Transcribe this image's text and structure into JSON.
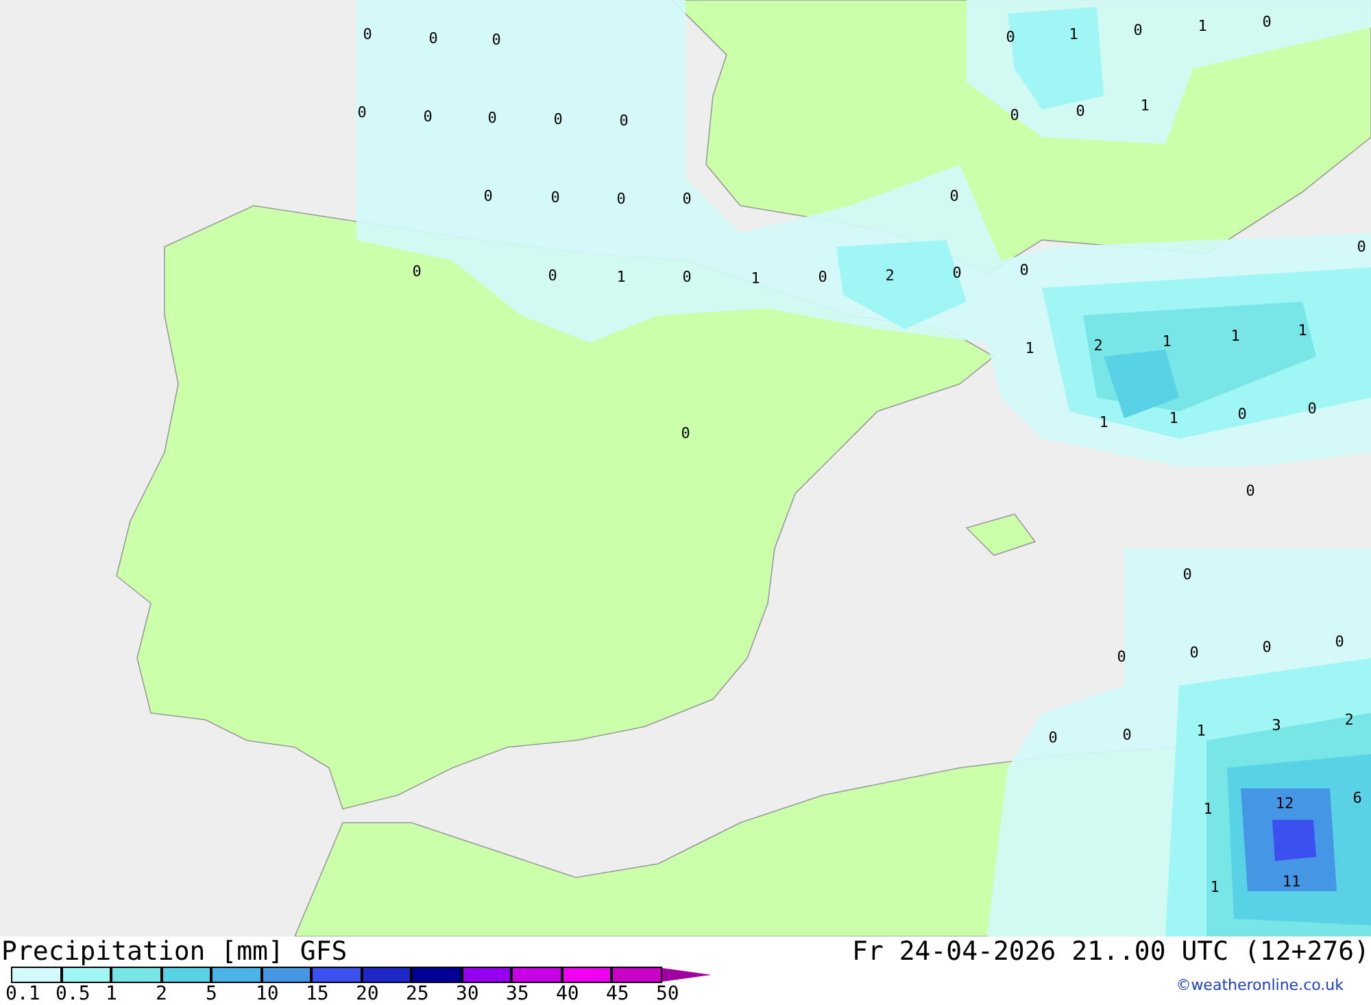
{
  "map": {
    "labels": [
      {
        "text": "0"
      },
      {
        "text": "0"
      },
      {
        "text": "0"
      },
      {
        "text": "0"
      },
      {
        "text": "1"
      },
      {
        "text": "0"
      },
      {
        "text": "1"
      },
      {
        "text": "0"
      },
      {
        "text": "0"
      },
      {
        "text": "0"
      },
      {
        "text": "0"
      },
      {
        "text": "0"
      },
      {
        "text": "0"
      },
      {
        "text": "0"
      },
      {
        "text": "0"
      },
      {
        "text": "1"
      },
      {
        "text": "0"
      },
      {
        "text": "0"
      },
      {
        "text": "0"
      },
      {
        "text": "0"
      },
      {
        "text": "0"
      },
      {
        "text": "0"
      },
      {
        "text": "0"
      },
      {
        "text": "1"
      },
      {
        "text": "0"
      },
      {
        "text": "1"
      },
      {
        "text": "0"
      },
      {
        "text": "2"
      },
      {
        "text": "0"
      },
      {
        "text": "0"
      },
      {
        "text": "0"
      },
      {
        "text": "1"
      },
      {
        "text": "2"
      },
      {
        "text": "1"
      },
      {
        "text": "1"
      },
      {
        "text": "1"
      },
      {
        "text": "1"
      },
      {
        "text": "1"
      },
      {
        "text": "0"
      },
      {
        "text": "0"
      },
      {
        "text": "0"
      },
      {
        "text": "0"
      },
      {
        "text": "0"
      },
      {
        "text": "0"
      },
      {
        "text": "0"
      },
      {
        "text": "0"
      },
      {
        "text": "0"
      },
      {
        "text": "0"
      },
      {
        "text": "0"
      },
      {
        "text": "1"
      },
      {
        "text": "3"
      },
      {
        "text": "2"
      },
      {
        "text": "1"
      },
      {
        "text": "12"
      },
      {
        "text": "6"
      },
      {
        "text": "1"
      },
      {
        "text": "11"
      }
    ]
  },
  "footer": {
    "title": "Precipitation [mm]",
    "model": "GFS",
    "date": "Fr 24-04-2026 21..00 UTC (12+276)",
    "credit": "©weatheronline.co.uk"
  },
  "legend": {
    "boxes": [
      {
        "color": "#d2fafa"
      },
      {
        "color": "#a0f5f5"
      },
      {
        "color": "#78e6e6"
      },
      {
        "color": "#5ad2e6"
      },
      {
        "color": "#4bb4e6"
      },
      {
        "color": "#4696e6"
      },
      {
        "color": "#3c50f0"
      },
      {
        "color": "#1e28c8"
      },
      {
        "color": "#000096"
      },
      {
        "color": "#9600f0"
      },
      {
        "color": "#c800e6"
      },
      {
        "color": "#f000f0"
      },
      {
        "color": "#c800c8"
      },
      {
        "kind": "arrow",
        "color": "#a000a0"
      }
    ],
    "labels": [
      "0.1",
      "0.5",
      "1",
      "2",
      "5",
      "10",
      "15",
      "20",
      "25",
      "30",
      "35",
      "40",
      "45",
      "50"
    ]
  }
}
